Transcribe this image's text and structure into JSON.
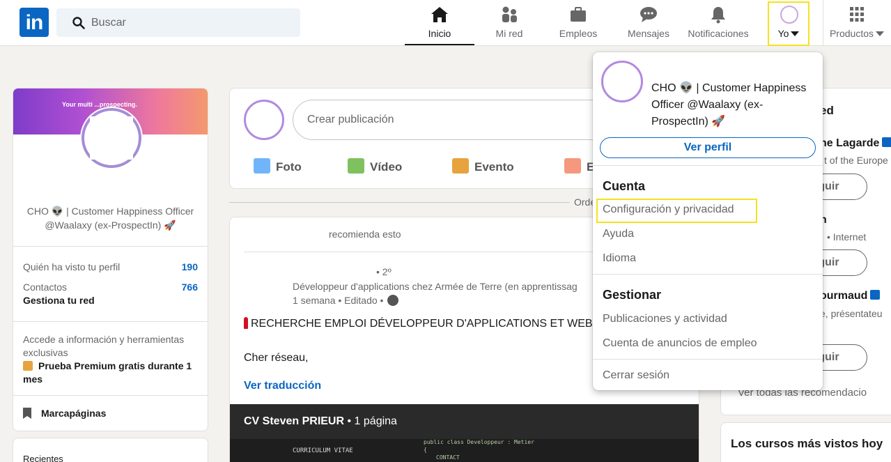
{
  "nav": {
    "search_placeholder": "Buscar",
    "items": [
      {
        "label": "Inicio",
        "icon": "home-icon"
      },
      {
        "label": "Mi red",
        "icon": "network-icon"
      },
      {
        "label": "Empleos",
        "icon": "briefcase-icon"
      },
      {
        "label": "Mensajes",
        "icon": "messages-icon"
      },
      {
        "label": "Notificaciones",
        "icon": "bell-icon"
      }
    ],
    "me_label": "Yo",
    "products_label": "Productos",
    "logo_text": "in"
  },
  "profile": {
    "banner_text": "Your multi ...prospecting.",
    "headline": "CHO 👽 | Customer Happiness Officer @Waalaxy (ex-ProspectIn) 🚀",
    "views_label": "Quién ha visto tu perfil",
    "views_value": "190",
    "contacts_label": "Contactos",
    "contacts_value": "766",
    "manage_network": "Gestiona tu red",
    "premium_text": "Accede a información y herramientas exclusivas",
    "premium_link": "Prueba Premium gratis durante 1 mes",
    "bookmarks": "Marcapáginas",
    "recents": "Recientes"
  },
  "post_box": {
    "placeholder": "Crear publicación",
    "actions": [
      "Foto",
      "Vídeo",
      "Evento",
      "E"
    ]
  },
  "order_label": "Orde",
  "feed": {
    "recommends": "recomienda esto",
    "degree": "• 2º",
    "author_title": "Développeur d'applications chez Armée de Terre (en apprentissag",
    "time": "1 semana • Editado •",
    "line1": "RECHERCHE EMPLOI DÉVELOPPEUR D'APPLICATIONS ET WEB",
    "line2": "Cher réseau,",
    "translate": "Ver traducción",
    "doc_title": "CV Steven PRIEUR",
    "doc_pages": "• 1 página",
    "code_lines": [
      "public class Developpeur : Metier",
      "{",
      "CONTACT"
    ],
    "code_side": "CURRICULUM VITAE"
  },
  "right": {
    "title": "ed",
    "people": [
      {
        "name": "ne Lagarde",
        "sub": "t of the Europe",
        "follow": "eguir"
      },
      {
        "name": "n",
        "sub": "• Internet",
        "follow": "eguir"
      },
      {
        "name": "ourmaud",
        "sub": "e, présentateu",
        "follow": "eguir"
      }
    ],
    "all_recs": "Ver todas las recomendacio",
    "courses": "Los cursos más vistos hoy"
  },
  "dropdown": {
    "headline": "CHO 👽 | Customer Happiness Officer @Waalaxy (ex-ProspectIn) 🚀",
    "view_profile": "Ver perfil",
    "account_title": "Cuenta",
    "account_items": [
      "Configuración y privacidad",
      "Ayuda",
      "Idioma"
    ],
    "manage_title": "Gestionar",
    "manage_items": [
      "Publicaciones y actividad",
      "Cuenta de anuncios de empleo"
    ],
    "logout": "Cerrar sesión"
  },
  "colors": {
    "brand": "#0a66c2",
    "highlight": "#f5e21f"
  }
}
